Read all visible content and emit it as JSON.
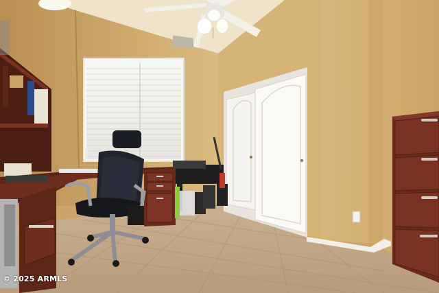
{
  "photo": {
    "subject": "home-office-bedroom",
    "watermark": "© 2025 ARMLS"
  },
  "colors": {
    "wall": "#d8b67a",
    "wall_shadow": "#c49c5c",
    "ceiling": "#efe4cc",
    "floor": "#cdb596",
    "closet_door": "#f4f1ec",
    "wood": "#6b2e1d",
    "chair": "#1c1f26"
  }
}
